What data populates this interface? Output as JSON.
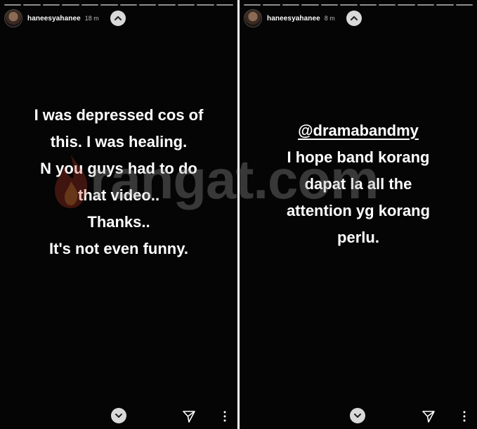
{
  "stories": [
    {
      "username": "haneesyahanee",
      "time": "18 m",
      "caption_lines": [
        "I was depressed cos of",
        "this. I was healing.",
        "N you guys had to do",
        "that video..",
        "Thanks..",
        "It's not even funny."
      ]
    },
    {
      "username": "haneesyahanee",
      "time": "8 m",
      "mention": "@dramabandmy",
      "caption_lines": [
        "I hope band korang",
        "dapat la all the",
        "attention yg korang",
        "perlu."
      ]
    }
  ],
  "watermark": {
    "text": "rangat.com"
  },
  "icons": {
    "up": "chevron-up-icon",
    "down": "chevron-down-icon",
    "send": "send-icon",
    "more": "more-vertical-icon",
    "watermark": "flame-icon"
  },
  "colors": {
    "background": "#050505",
    "text": "#ffffff",
    "button": "#d9d9d9"
  }
}
